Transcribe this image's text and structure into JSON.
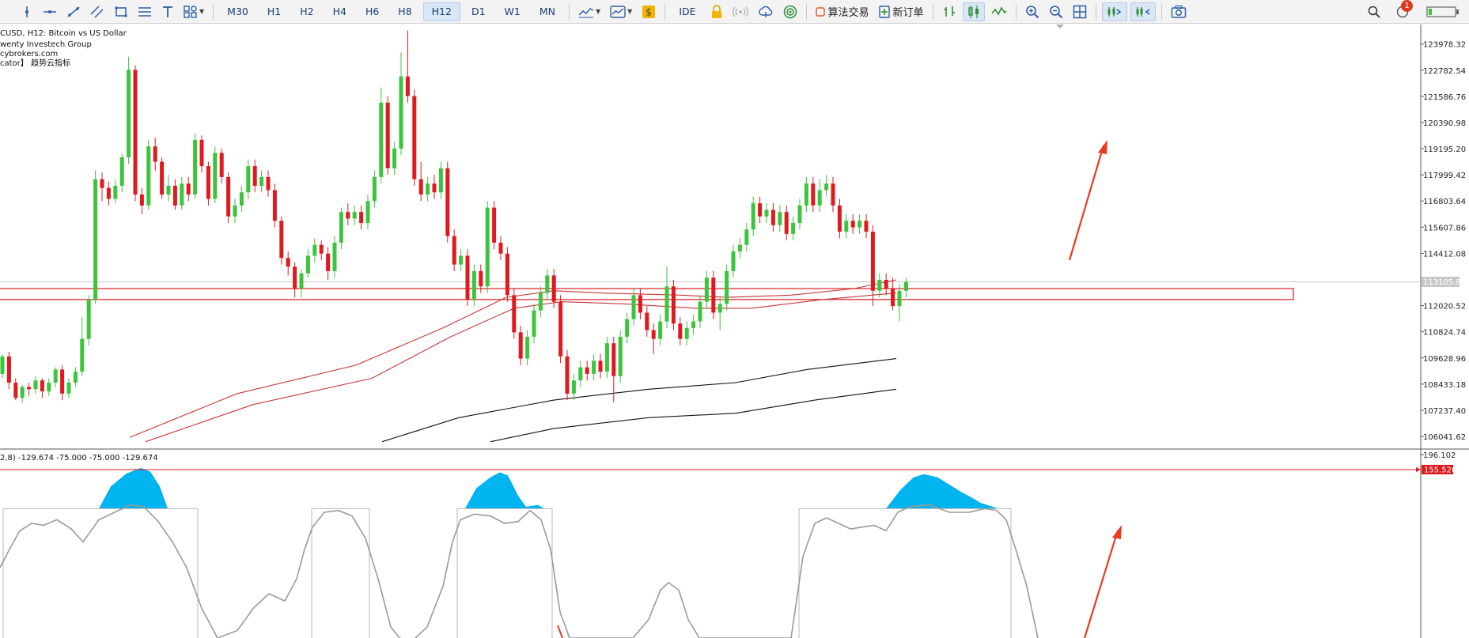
{
  "toolbar": {
    "timeframes": [
      "M30",
      "H1",
      "H2",
      "H4",
      "H6",
      "H8",
      "H12",
      "D1",
      "W1",
      "MN"
    ],
    "active_timeframe": "H12",
    "ide_label": "IDE",
    "algo_trading_label": "算法交易",
    "new_order_label": "新订单",
    "notification_count": "1",
    "icons": [
      "cursor-icon",
      "vertical-line-icon",
      "horizontal-line-icon",
      "trend-line-icon",
      "channel-icon",
      "rectangle-icon",
      "fibonacci-icon",
      "text-icon",
      "shapes-icon",
      "chart-type-icon",
      "template-icon",
      "market-icon",
      "signal-icon",
      "cloud-icon",
      "vps-icon",
      "zoom-in-icon",
      "zoom-out-icon",
      "grid-icon",
      "autoscroll-icon",
      "chart-shift-icon",
      "screenshot-icon",
      "search-icon",
      "battery-icon"
    ]
  },
  "chart_info": {
    "line1": "CUSD, H12:  Bitcoin vs US Dollar",
    "line2": "wenty Investech Group",
    "line3": "cybrokers.com",
    "line4": "cator】 趋势云指标"
  },
  "main_axis": {
    "ticks": [
      "123978.32",
      "122782.54",
      "121586.76",
      "120390.98",
      "119195.20",
      "117999.42",
      "116803.64",
      "115607.86",
      "114412.08",
      "112020.52",
      "110824.74",
      "109628.96",
      "108433.18",
      "107237.40",
      "106041.62"
    ],
    "current_price_label": "113105.86"
  },
  "indicator": {
    "header": "2,8) -129.674 -75.000 -75.000 -129.674",
    "axis_top": "196.102",
    "level_label": "155.526"
  },
  "colors": {
    "bull": "#3cc43c",
    "bear": "#e0191e",
    "ma_red": "#c93535",
    "ma_black": "#111111",
    "hist_fill": "#00b4ef",
    "level_line": "#e0191e",
    "arrow": "#ea3a22"
  },
  "chart_data": {
    "type": "candlestick",
    "timeframe": "H12",
    "y_range": [
      105500,
      124800
    ],
    "zone": [
      112300,
      112800
    ],
    "current_price": 113105.86,
    "candles": [
      [
        108900,
        109700,
        108700,
        109800
      ],
      [
        109700,
        108500,
        108200,
        109900
      ],
      [
        108500,
        107800,
        107700,
        108700
      ],
      [
        107800,
        108300,
        107600,
        108400
      ],
      [
        108300,
        108200,
        107900,
        108500
      ],
      [
        108200,
        108600,
        108000,
        108800
      ],
      [
        108600,
        108100,
        107800,
        108700
      ],
      [
        108100,
        108500,
        107900,
        108700
      ],
      [
        108500,
        109100,
        108300,
        109200
      ],
      [
        109100,
        108000,
        107700,
        109300
      ],
      [
        108000,
        108500,
        107800,
        108700
      ],
      [
        108500,
        109000,
        108300,
        109200
      ],
      [
        109000,
        110500,
        108800,
        111500
      ],
      [
        110500,
        112300,
        110200,
        112500
      ],
      [
        112300,
        117800,
        112100,
        118200
      ],
      [
        117800,
        117400,
        116800,
        118100
      ],
      [
        117400,
        116900,
        116600,
        117700
      ],
      [
        116900,
        117500,
        116700,
        117800
      ],
      [
        117500,
        118800,
        117200,
        119000
      ],
      [
        118800,
        122800,
        118500,
        123400
      ],
      [
        122800,
        117100,
        116800,
        123000
      ],
      [
        117100,
        116600,
        116200,
        117400
      ],
      [
        116600,
        119300,
        116400,
        119600
      ],
      [
        119300,
        118600,
        118200,
        119700
      ],
      [
        118600,
        117100,
        116900,
        118800
      ],
      [
        117100,
        117500,
        116800,
        118000
      ],
      [
        117500,
        116600,
        116400,
        117800
      ],
      [
        116600,
        117600,
        116400,
        117900
      ],
      [
        117600,
        117100,
        116800,
        117900
      ],
      [
        117100,
        119600,
        116900,
        119900
      ],
      [
        119600,
        118400,
        118100,
        119800
      ],
      [
        118400,
        116900,
        116600,
        118600
      ],
      [
        116900,
        119000,
        116700,
        119300
      ],
      [
        119000,
        117900,
        117600,
        119200
      ],
      [
        117900,
        116100,
        115800,
        118100
      ],
      [
        116100,
        116600,
        115800,
        116900
      ],
      [
        116600,
        117200,
        116300,
        117500
      ],
      [
        117200,
        118400,
        116900,
        118700
      ],
      [
        118400,
        117500,
        117200,
        118700
      ],
      [
        117500,
        117900,
        117200,
        118200
      ],
      [
        117900,
        117300,
        117000,
        118200
      ],
      [
        117300,
        115900,
        115600,
        117600
      ],
      [
        115900,
        114200,
        113900,
        116100
      ],
      [
        114200,
        113800,
        113400,
        114500
      ],
      [
        113800,
        112800,
        112400,
        114000
      ],
      [
        112800,
        113500,
        112400,
        113700
      ],
      [
        113500,
        114300,
        113300,
        114600
      ],
      [
        114300,
        114800,
        114000,
        115100
      ],
      [
        114800,
        114400,
        114100,
        115000
      ],
      [
        114400,
        113600,
        113200,
        114700
      ],
      [
        113600,
        114900,
        113300,
        115200
      ],
      [
        114900,
        116300,
        114600,
        116500
      ],
      [
        116300,
        116000,
        115700,
        116700
      ],
      [
        116000,
        116300,
        115700,
        116600
      ],
      [
        116300,
        115800,
        115500,
        116600
      ],
      [
        115800,
        116800,
        115500,
        117100
      ],
      [
        116800,
        117900,
        116500,
        118200
      ],
      [
        117900,
        121300,
        117600,
        122000
      ],
      [
        121300,
        118300,
        118000,
        121600
      ],
      [
        118300,
        119200,
        118000,
        119500
      ],
      [
        119200,
        122500,
        118900,
        123600
      ],
      [
        122500,
        121600,
        121300,
        124600
      ],
      [
        121600,
        117800,
        117500,
        121900
      ],
      [
        117800,
        117100,
        116800,
        118600
      ],
      [
        117100,
        117600,
        116800,
        117900
      ],
      [
        117600,
        117200,
        116900,
        118000
      ],
      [
        117200,
        118300,
        116900,
        118600
      ],
      [
        118300,
        115200,
        114900,
        118600
      ],
      [
        115200,
        113900,
        113600,
        115500
      ],
      [
        113900,
        114300,
        113600,
        114600
      ],
      [
        114300,
        112300,
        112000,
        114600
      ],
      [
        112300,
        113600,
        112000,
        113900
      ],
      [
        113600,
        112900,
        112600,
        113900
      ],
      [
        112900,
        116500,
        112600,
        116800
      ],
      [
        116500,
        114900,
        114600,
        116800
      ],
      [
        114900,
        114400,
        114100,
        115200
      ],
      [
        114400,
        112500,
        112200,
        114700
      ],
      [
        112500,
        110800,
        110500,
        112800
      ],
      [
        110800,
        109600,
        109300,
        111100
      ],
      [
        109600,
        110600,
        109300,
        110900
      ],
      [
        110600,
        111800,
        110300,
        112100
      ],
      [
        111800,
        112600,
        111500,
        112900
      ],
      [
        112600,
        113400,
        112300,
        113700
      ],
      [
        113400,
        112200,
        111900,
        113700
      ],
      [
        112200,
        109700,
        109400,
        112500
      ],
      [
        109700,
        108000,
        107700,
        110000
      ],
      [
        108000,
        108600,
        107700,
        108900
      ],
      [
        108600,
        109200,
        108300,
        109500
      ],
      [
        109200,
        108900,
        108600,
        109500
      ],
      [
        108900,
        109500,
        108600,
        109800
      ],
      [
        109500,
        109000,
        108700,
        109800
      ],
      [
        109000,
        110300,
        108700,
        110600
      ],
      [
        110300,
        108800,
        107600,
        110600
      ],
      [
        108800,
        110600,
        108500,
        110900
      ],
      [
        110600,
        111400,
        110300,
        111700
      ],
      [
        111400,
        112500,
        111100,
        112800
      ],
      [
        112500,
        111700,
        111400,
        112800
      ],
      [
        111700,
        110900,
        110600,
        112000
      ],
      [
        110900,
        110500,
        109800,
        111200
      ],
      [
        110500,
        111300,
        110200,
        111600
      ],
      [
        111300,
        112900,
        111000,
        113800
      ],
      [
        112900,
        111200,
        110900,
        113200
      ],
      [
        111200,
        110500,
        110200,
        111500
      ],
      [
        110500,
        111000,
        110200,
        111300
      ],
      [
        111000,
        111300,
        110700,
        111600
      ],
      [
        111300,
        112200,
        111000,
        112500
      ],
      [
        112200,
        113300,
        111900,
        113600
      ],
      [
        113300,
        111700,
        111400,
        113600
      ],
      [
        111700,
        112100,
        110900,
        112400
      ],
      [
        112100,
        113600,
        111800,
        113900
      ],
      [
        113600,
        114500,
        113300,
        114800
      ],
      [
        114500,
        114800,
        114200,
        115100
      ],
      [
        114800,
        115500,
        114500,
        115800
      ],
      [
        115500,
        116700,
        115200,
        117000
      ],
      [
        116700,
        116100,
        115800,
        117000
      ],
      [
        116100,
        116400,
        115800,
        116700
      ],
      [
        116400,
        115700,
        115400,
        116700
      ],
      [
        115700,
        116300,
        115400,
        116600
      ],
      [
        116300,
        115300,
        115000,
        116600
      ],
      [
        115300,
        115800,
        115000,
        116100
      ],
      [
        115800,
        116600,
        115500,
        116900
      ],
      [
        116600,
        117600,
        116300,
        117900
      ],
      [
        117600,
        116600,
        116300,
        117900
      ],
      [
        116600,
        117300,
        116300,
        117800
      ],
      [
        117300,
        117600,
        117000,
        118000
      ],
      [
        117600,
        116600,
        116300,
        117900
      ],
      [
        116600,
        115400,
        115100,
        116900
      ],
      [
        115400,
        115900,
        115100,
        116200
      ],
      [
        115900,
        115600,
        115300,
        116200
      ],
      [
        115600,
        115900,
        115300,
        116200
      ],
      [
        115900,
        115400,
        115100,
        116200
      ],
      [
        115400,
        112700,
        112000,
        115700
      ],
      [
        112700,
        113200,
        112400,
        113500
      ],
      [
        113200,
        112800,
        112500,
        113500
      ],
      [
        112800,
        112000,
        111800,
        113300
      ],
      [
        112000,
        112700,
        111300,
        113000
      ],
      [
        112700,
        113100,
        112400,
        113300
      ]
    ],
    "ma_red_upper": [
      [
        164,
        106000
      ],
      [
        300,
        108000
      ],
      [
        450,
        109300
      ],
      [
        560,
        111000
      ],
      [
        640,
        112400
      ],
      [
        700,
        112700
      ],
      [
        760,
        112600
      ],
      [
        860,
        112500
      ],
      [
        920,
        112400
      ],
      [
        1000,
        112500
      ],
      [
        1080,
        112800
      ],
      [
        1133,
        113200
      ]
    ],
    "ma_red_lower": [
      [
        184,
        105800
      ],
      [
        320,
        107500
      ],
      [
        470,
        108700
      ],
      [
        570,
        110600
      ],
      [
        650,
        111900
      ],
      [
        710,
        112200
      ],
      [
        790,
        112100
      ],
      [
        880,
        111900
      ],
      [
        950,
        111900
      ],
      [
        1040,
        112300
      ],
      [
        1133,
        112600
      ]
    ],
    "ma_black_upper": [
      [
        483,
        105800
      ],
      [
        580,
        106900
      ],
      [
        700,
        107700
      ],
      [
        820,
        108200
      ],
      [
        930,
        108500
      ],
      [
        1020,
        109100
      ],
      [
        1133,
        109600
      ]
    ],
    "ma_black_lower": [
      [
        620,
        105800
      ],
      [
        700,
        106400
      ],
      [
        820,
        106900
      ],
      [
        930,
        107100
      ],
      [
        1030,
        107700
      ],
      [
        1133,
        108200
      ]
    ],
    "indicator_y_range": [
      -300,
      196.102
    ],
    "indicator_level": 155.526
  }
}
